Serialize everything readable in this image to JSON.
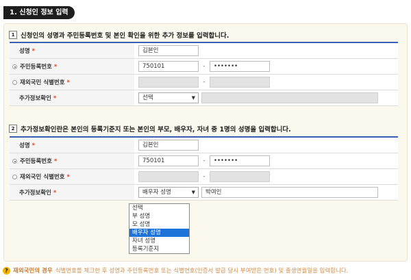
{
  "section": {
    "title": "1. 신청인 정보 입력"
  },
  "block1": {
    "num": "1",
    "heading": "신청인의 성명과 주민등록번호 및 본인 확인을 위한 추가 정보를 입력합니다.",
    "name_label": "성명",
    "name_value": "김본인",
    "rrn_label": "주민등록번호",
    "rrn_front": "750101",
    "rrn_back": "•••••••",
    "foreign_label": "재외국민 식별번호",
    "extra_label": "추가정보확인",
    "extra_select": "선택"
  },
  "block2": {
    "num": "2",
    "heading": "추가정보확인란은 본인의 등록기준지 또는 본인의 부모, 배우자, 자녀 중 1명의 성명을 입력합니다.",
    "name_label": "성명",
    "name_value": "김본인",
    "rrn_label": "주민등록번호",
    "rrn_front": "750101",
    "rrn_back": "•••••••",
    "foreign_label": "재외국민 식별번호",
    "extra_label": "추가정보확인",
    "extra_select": "배우자 성명",
    "extra_value": "박여인",
    "options": [
      "선택",
      "부 성명",
      "모 성명",
      "배우자 성명",
      "자녀 성명",
      "등록기준지"
    ],
    "highlighted_option": "배우자 성명"
  },
  "star": "*",
  "footnote": {
    "icon": "?",
    "strong": "재외국민의 경우",
    "rest": "식별번호를 체크한 후 성명과 주민등록번호 또는 식별번호(인증서 발급 당시 부여받은 번호) 및 출생연월일을 입력합니다."
  },
  "colors": {
    "accent": "#3a5fb0",
    "star": "#e5431a",
    "highlight": "#1e73d8",
    "note": "#c8782a"
  }
}
